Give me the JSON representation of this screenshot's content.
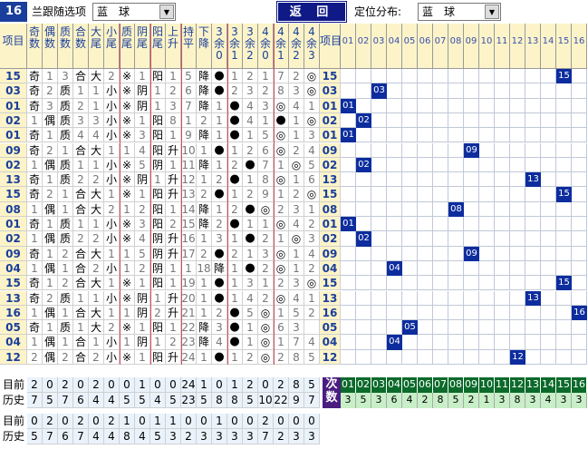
{
  "toolbar": {
    "issue": "16",
    "select_label": "兰跟随选项",
    "select_value": "蓝　球",
    "back_label": "返 回",
    "dist_label": "定位分布:",
    "dist_value": "蓝　球"
  },
  "headers": [
    "项目",
    "奇数",
    "偶数",
    "质数",
    "合数",
    "大尾",
    "小尾",
    "质尾",
    "阴尾",
    "阳尾",
    "上升",
    "持平",
    "下降",
    "3余0",
    "3余1",
    "3余2",
    "4余0",
    "4余1",
    "4余2",
    "4余3",
    "项目"
  ],
  "dist_headers": [
    "01",
    "02",
    "03",
    "04",
    "05",
    "06",
    "07",
    "08",
    "09",
    "10",
    "11",
    "12",
    "13",
    "14",
    "15",
    "16"
  ],
  "rows": [
    {
      "item": "15",
      "v": [
        "奇",
        "1",
        "3",
        "合",
        "大",
        "2",
        "※",
        "1",
        "阳",
        "1",
        "5",
        "降",
        "●",
        "1",
        "2",
        "1",
        "7",
        "2",
        "◎"
      ],
      "ball": "15"
    },
    {
      "item": "03",
      "v": [
        "奇",
        "2",
        "质",
        "1",
        "1",
        "小",
        "※",
        "阴",
        "1",
        "2",
        "6",
        "降",
        "●",
        "2",
        "3",
        "2",
        "8",
        "3",
        "◎"
      ],
      "ball": "03"
    },
    {
      "item": "01",
      "v": [
        "奇",
        "3",
        "质",
        "2",
        "1",
        "小",
        "※",
        "阴",
        "1",
        "3",
        "7",
        "降",
        "1",
        "●",
        "4",
        "3",
        "◎",
        "4",
        "1"
      ],
      "ball": "01"
    },
    {
      "item": "02",
      "v": [
        "1",
        "偶",
        "质",
        "3",
        "3",
        "小",
        "※",
        "1",
        "阳",
        "8",
        "1",
        "2",
        "1",
        "●",
        "4",
        "1",
        "●",
        "1",
        "◎",
        "2"
      ],
      "ball": "02"
    },
    {
      "item": "01",
      "v": [
        "奇",
        "1",
        "质",
        "4",
        "4",
        "小",
        "※",
        "3",
        "阳",
        "1",
        "9",
        "降",
        "1",
        "●",
        "1",
        "5",
        "◎",
        "1",
        "3"
      ],
      "ball": "01"
    },
    {
      "item": "09",
      "v": [
        "奇",
        "2",
        "1",
        "合",
        "大",
        "1",
        "1",
        "4",
        "阳",
        "升",
        "10",
        "1",
        "●",
        "1",
        "2",
        "6",
        "◎",
        "2",
        "4"
      ],
      "ball": "09"
    },
    {
      "item": "02",
      "v": [
        "1",
        "偶",
        "质",
        "1",
        "1",
        "小",
        "※",
        "5",
        "阴",
        "1",
        "11",
        "降",
        "1",
        "2",
        "●",
        "7",
        "1",
        "◎",
        "5"
      ],
      "ball": "02"
    },
    {
      "item": "13",
      "v": [
        "奇",
        "1",
        "质",
        "2",
        "2",
        "小",
        "※",
        "阴",
        "1",
        "升",
        "12",
        "1",
        "2",
        "●",
        "1",
        "8",
        "◎",
        "1",
        "6"
      ],
      "ball": "13"
    },
    {
      "item": "15",
      "v": [
        "奇",
        "2",
        "1",
        "合",
        "大",
        "1",
        "※",
        "1",
        "阳",
        "升",
        "13",
        "2",
        "●",
        "1",
        "2",
        "9",
        "1",
        "2",
        "◎"
      ],
      "ball": "15"
    },
    {
      "item": "08",
      "v": [
        "1",
        "偶",
        "1",
        "合",
        "大",
        "2",
        "1",
        "2",
        "阳",
        "1",
        "14",
        "降",
        "1",
        "2",
        "●",
        "◎",
        "2",
        "3",
        "1"
      ],
      "ball": "08"
    },
    {
      "item": "01",
      "v": [
        "奇",
        "1",
        "质",
        "1",
        "1",
        "小",
        "※",
        "3",
        "阳",
        "2",
        "15",
        "降",
        "2",
        "●",
        "1",
        "1",
        "◎",
        "4",
        "2"
      ],
      "ball": "01"
    },
    {
      "item": "02",
      "v": [
        "1",
        "偶",
        "质",
        "2",
        "2",
        "小",
        "※",
        "4",
        "阴",
        "升",
        "16",
        "1",
        "3",
        "1",
        "●",
        "2",
        "1",
        "◎",
        "3"
      ],
      "ball": "02"
    },
    {
      "item": "09",
      "v": [
        "奇",
        "1",
        "2",
        "合",
        "大",
        "1",
        "1",
        "5",
        "阴",
        "升",
        "17",
        "2",
        "●",
        "2",
        "1",
        "3",
        "◎",
        "1",
        "4"
      ],
      "ball": "09"
    },
    {
      "item": "04",
      "v": [
        "1",
        "偶",
        "1",
        "合",
        "2",
        "小",
        "1",
        "2",
        "阴",
        "1",
        "1",
        "18",
        "降",
        "1",
        "●",
        "2",
        "◎",
        "1",
        "2",
        "5"
      ],
      "ball": "04"
    },
    {
      "item": "15",
      "v": [
        "奇",
        "1",
        "2",
        "合",
        "大",
        "1",
        "※",
        "1",
        "阳",
        "1",
        "19",
        "1",
        "●",
        "1",
        "3",
        "1",
        "2",
        "3",
        "◎"
      ],
      "ball": "15"
    },
    {
      "item": "13",
      "v": [
        "奇",
        "2",
        "质",
        "1",
        "1",
        "小",
        "※",
        "阴",
        "1",
        "升",
        "20",
        "1",
        "●",
        "1",
        "4",
        "2",
        "◎",
        "4",
        "1"
      ],
      "ball": "13"
    },
    {
      "item": "16",
      "v": [
        "1",
        "偶",
        "1",
        "合",
        "大",
        "1",
        "1",
        "阴",
        "2",
        "升",
        "21",
        "1",
        "2",
        "●",
        "5",
        "◎",
        "1",
        "5",
        "2"
      ],
      "ball": "16"
    },
    {
      "item": "05",
      "v": [
        "奇",
        "1",
        "质",
        "1",
        "大",
        "2",
        "※",
        "1",
        "阳",
        "1",
        "22",
        "降",
        "3",
        "●",
        "1",
        "◎",
        "6",
        "3"
      ],
      "ball": "05"
    },
    {
      "item": "04",
      "v": [
        "1",
        "偶",
        "1",
        "合",
        "1",
        "小",
        "1",
        "阴",
        "1",
        "2",
        "23",
        "降",
        "4",
        "●",
        "1",
        "◎",
        "1",
        "7",
        "4"
      ],
      "ball": "04"
    },
    {
      "item": "12",
      "v": [
        "2",
        "偶",
        "2",
        "合",
        "2",
        "小",
        "※",
        "1",
        "阳",
        "升",
        "24",
        "1",
        "●",
        "1",
        "2",
        "◎",
        "2",
        "8",
        "5"
      ],
      "ball": "12"
    }
  ],
  "bottom": {
    "cur_label": "目前",
    "hist_label": "历史",
    "cur": [
      "2",
      "0",
      "2",
      "0",
      "2",
      "0",
      "0",
      "1",
      "0",
      "0",
      "24",
      "1",
      "0",
      "1",
      "2",
      "0",
      "2",
      "8",
      "5"
    ],
    "hist": [
      "7",
      "5",
      "7",
      "6",
      "4",
      "4",
      "5",
      "5",
      "4",
      "5",
      "23",
      "5",
      "8",
      "8",
      "5",
      "10",
      "22",
      "9",
      "7"
    ],
    "cishu_label": "次数",
    "nums": [
      "01",
      "02",
      "03",
      "04",
      "05",
      "06",
      "07",
      "08",
      "09",
      "10",
      "11",
      "12",
      "13",
      "14",
      "15",
      "16"
    ],
    "counts": [
      "3",
      "5",
      "3",
      "6",
      "4",
      "2",
      "8",
      "5",
      "2",
      "1",
      "3",
      "8",
      "3",
      "4",
      "3",
      "3"
    ],
    "cur2": [
      "0",
      "2",
      "0",
      "2",
      "0",
      "2",
      "1",
      "0",
      "1",
      "1",
      "0",
      "0",
      "1",
      "0",
      "0",
      "2",
      "0",
      "0",
      "0"
    ],
    "hist2": [
      "5",
      "7",
      "6",
      "7",
      "4",
      "4",
      "8",
      "4",
      "5",
      "3",
      "2",
      "3",
      "3",
      "3",
      "3",
      "7",
      "2",
      "3",
      "3"
    ]
  },
  "colors": {
    "ball": "#0d2d9e",
    "header_bg": "#fcf4c8",
    "button": "#0f1a86"
  }
}
